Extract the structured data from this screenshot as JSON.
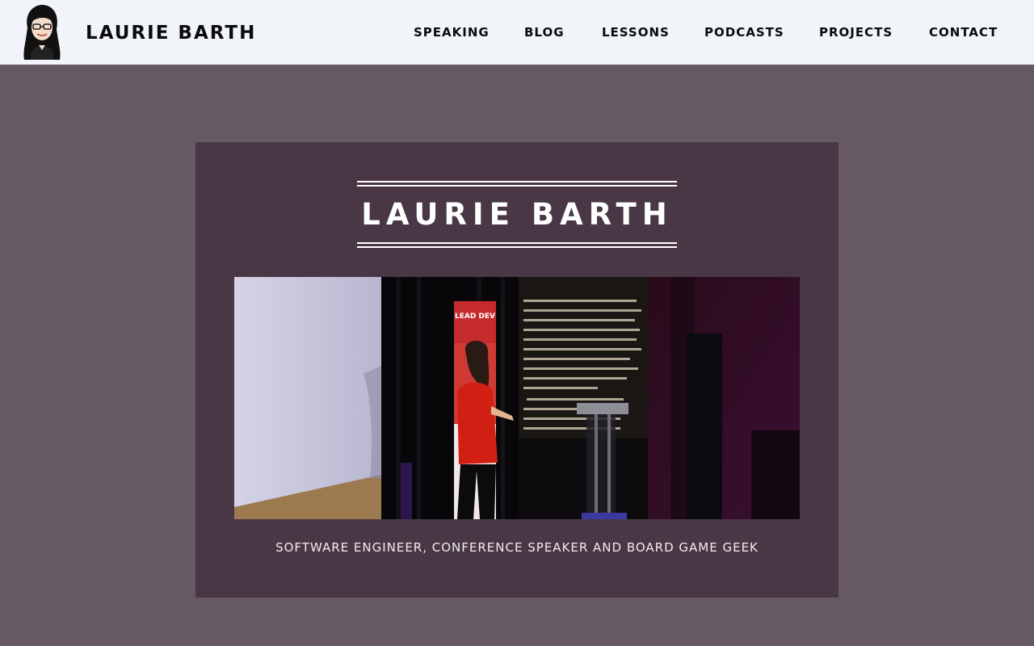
{
  "header": {
    "site_title": "LAURIE BARTH",
    "avatar_icon": "cartoon-portrait-icon",
    "background": "#f1f5fa"
  },
  "nav": {
    "items": [
      {
        "label": "SPEAKING"
      },
      {
        "label": "BLOG"
      },
      {
        "label": "LESSONS"
      },
      {
        "label": "PODCASTS"
      },
      {
        "label": "PROJECTS"
      },
      {
        "label": "CONTACT"
      }
    ]
  },
  "hero": {
    "heading": "LAURIE BARTH",
    "tagline": "SOFTWARE ENGINEER, CONFERENCE SPEAKER AND BOARD GAME GEEK",
    "photo_banner_text": "LEAD DEV",
    "colors": {
      "page_background": "#655964",
      "card_background": "#4a3745",
      "heading": "#ffffff"
    }
  }
}
